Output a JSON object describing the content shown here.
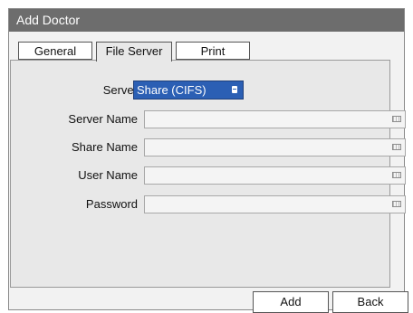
{
  "window": {
    "title": "Add Doctor"
  },
  "tabs": [
    {
      "label": "General",
      "active": false
    },
    {
      "label": "File Server",
      "active": true
    },
    {
      "label": "Print",
      "active": false
    }
  ],
  "form": {
    "server": {
      "label": "Server",
      "value": "Share (CIFS)"
    },
    "server_name": {
      "label": "Server Name",
      "value": ""
    },
    "share_name": {
      "label": "Share Name",
      "value": ""
    },
    "user_name": {
      "label": "User Name",
      "value": ""
    },
    "password": {
      "label": "Password",
      "value": ""
    }
  },
  "buttons": {
    "add": "Add",
    "back": "Back"
  },
  "colors": {
    "titlebar": "#6d6d6d",
    "accent": "#2b5fb4"
  },
  "icons": {
    "keyboard": "keyboard-icon",
    "select": "dropdown-icon"
  }
}
